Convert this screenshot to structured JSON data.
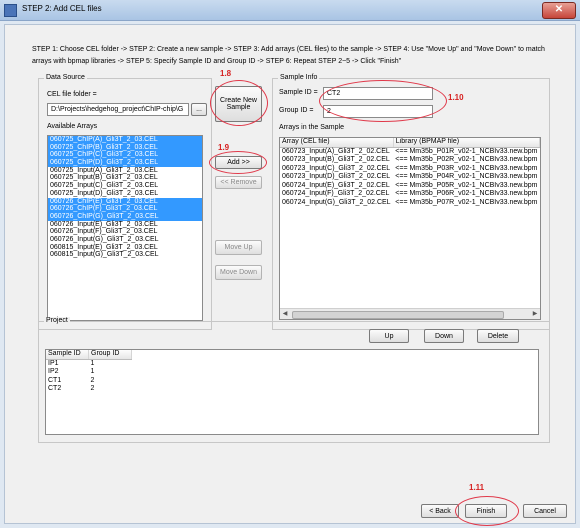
{
  "window": {
    "title": "STEP 2: Add CEL files",
    "close_label": "✕"
  },
  "instructions": "STEP 1: Choose CEL folder -> STEP 2: Create a new sample -> STEP 3: Add arrays (CEL files) to the sample -> STEP 4: Use \"Move Up\" and \"Move Down\" to match arrays with bpmap libraries -> STEP 5: Specify Sample ID and Group ID -> STEP 6: Repeat STEP 2~5 -> Click \"Finish\"",
  "data_source": {
    "group_label": "Data Source",
    "folder_label": "CEL file folder =",
    "folder_value": "D:\\Projects\\hedgehog_project\\ChIP-chip\\G",
    "browse_label": "...",
    "available_label": "Available Arrays",
    "arrays": [
      {
        "name": "060725_ChIP(A)_Gli3T_2_03.CEL",
        "selected": true
      },
      {
        "name": "060725_ChIP(B)_Gli3T_2_03.CEL",
        "selected": true
      },
      {
        "name": "060725_ChIP(C)_Gli3T_2_03.CEL",
        "selected": true
      },
      {
        "name": "060725_ChIP(D)_Gli3T_2_03.CEL",
        "selected": true
      },
      {
        "name": "060725_Input(A)_Gli3T_2_03.CEL",
        "selected": false
      },
      {
        "name": "060725_Input(B)_Gli3T_2_03.CEL",
        "selected": false
      },
      {
        "name": "060725_Input(C)_Gli3T_2_03.CEL",
        "selected": false
      },
      {
        "name": "060725_Input(D)_Gli3T_2_03.CEL",
        "selected": false
      },
      {
        "name": "060726_ChIP(E)_Gli3T_2_03.CEL",
        "selected": true
      },
      {
        "name": "060726_ChIP(F)_Gli3T_2_03.CEL",
        "selected": true
      },
      {
        "name": "060726_ChIP(G)_Gli3T_2_03.CEL",
        "selected": true
      },
      {
        "name": "060726_Input(E)_Gli3T_2_03.CEL",
        "selected": false
      },
      {
        "name": "060726_Input(F)_Gli3T_2_03.CEL",
        "selected": false
      },
      {
        "name": "060726_Input(G)_Gli3T_2_03.CEL",
        "selected": false
      },
      {
        "name": "060815_Input(E)_Gli3T_2_03.CEL",
        "selected": false
      },
      {
        "name": "060815_Input(G)_Gli3T_2_03.CEL",
        "selected": false
      }
    ]
  },
  "actions": {
    "create_sample": "Create New Sample",
    "add": "Add >>",
    "remove": "<< Remove",
    "move_up": "Move Up",
    "move_down": "Move Down"
  },
  "sample_info": {
    "group_label": "Sample Info",
    "sample_id_label": "Sample ID =",
    "sample_id_value": "CT2",
    "group_id_label": "Group ID =",
    "group_id_value": "2",
    "arrays_label": "Arrays in the Sample",
    "col_array": "Array (CEL file)",
    "col_library": "Library (BPMAP file)",
    "rows": [
      {
        "array": "060723_Input(A)_Gli3T_2_02.CEL",
        "library": "<== Mm35b_P01R_v02-1_NCBIv33.new.bpm"
      },
      {
        "array": "060723_Input(B)_Gli3T_2_02.CEL",
        "library": "<== Mm35b_P02R_v02-1_NCBIv33.new.bpm"
      },
      {
        "array": "060723_Input(C)_Gli3T_2_02.CEL",
        "library": "<== Mm35b_P03R_v02-1_NCBIv33.new.bpm"
      },
      {
        "array": "060723_Input(D)_Gli3T_2_02.CEL",
        "library": "<== Mm35b_P04R_v02-1_NCBIv33.new.bpm"
      },
      {
        "array": "060724_Input(E)_Gli3T_2_02.CEL",
        "library": "<== Mm35b_P05R_v02-1_NCBIv33.new.bpm"
      },
      {
        "array": "060724_Input(F)_Gli3T_2_02.CEL",
        "library": "<== Mm35b_P06R_v02-1_NCBIv33.new.bpm"
      },
      {
        "array": "060724_Input(G)_Gli3T_2_02.CEL",
        "library": "<== Mm35b_P07R_v02-1_NCBIv33.new.bpm"
      }
    ]
  },
  "project": {
    "group_label": "Project",
    "up": "Up",
    "down": "Down",
    "delete": "Delete",
    "col_sample": "Sample ID",
    "col_group": "Group ID",
    "rows": [
      {
        "sample": "IP1",
        "group": "1"
      },
      {
        "sample": "IP2",
        "group": "1"
      },
      {
        "sample": "CT1",
        "group": "2"
      },
      {
        "sample": "CT2",
        "group": "2"
      }
    ]
  },
  "footer": {
    "back": "< Back",
    "finish": "Finish",
    "cancel": "Cancel"
  },
  "annotations": {
    "a18": "1.8",
    "a19": "1.9",
    "a110": "1.10",
    "a111": "1.11"
  },
  "colors": {
    "selection": "#3399ff",
    "annotation": "#d61f1f"
  }
}
